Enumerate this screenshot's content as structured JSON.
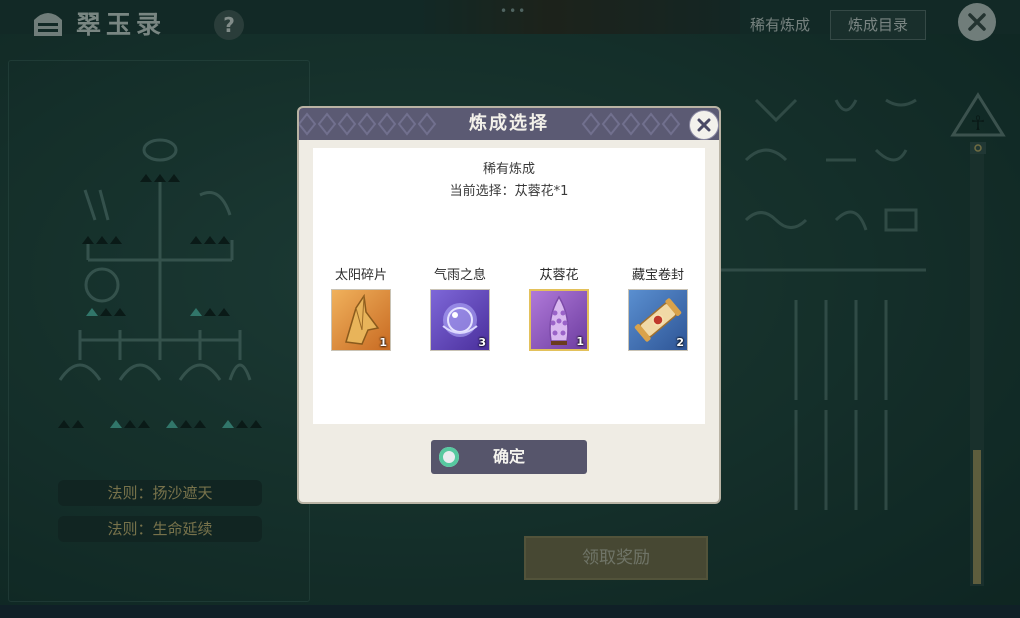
{
  "app": {
    "title": "翠玉录"
  },
  "header": {
    "help_label": "?",
    "drag_dots": "•••",
    "rare_refine_label": "稀有炼成",
    "catalog_label": "炼成目录"
  },
  "rules": [
    {
      "label": "法则：扬沙遮天"
    },
    {
      "label": "法则：生命延续"
    }
  ],
  "reward_button": {
    "label": "领取奖励"
  },
  "modal": {
    "title": "炼成选择",
    "subtitle": "稀有炼成",
    "current_selection": "当前选择：苁蓉花*1",
    "confirm_label": "确定",
    "items": [
      {
        "name": "太阳碎片",
        "count": "1",
        "icon": "sun-shard-icon",
        "selected": false,
        "color": "#d8892f"
      },
      {
        "name": "气雨之息",
        "count": "3",
        "icon": "rain-breath-orb-icon",
        "selected": false,
        "color": "#6a4fc2"
      },
      {
        "name": "苁蓉花",
        "count": "1",
        "icon": "cistanche-flower-icon",
        "selected": true,
        "color": "#8a5bb8"
      },
      {
        "name": "藏宝卷封",
        "count": "2",
        "icon": "treasure-scroll-icon",
        "selected": false,
        "color": "#3f6fae"
      }
    ]
  },
  "colors": {
    "modal_header": "#5b5a73",
    "confirm_button": "#56556b",
    "selection_border": "#e3c15b",
    "rule_text": "#d6c07a"
  }
}
